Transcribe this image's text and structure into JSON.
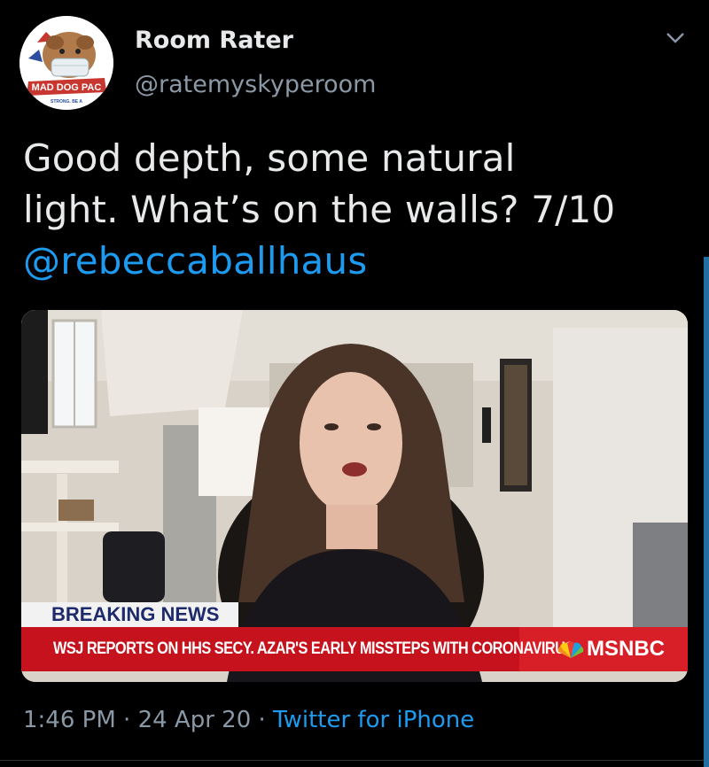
{
  "tweet": {
    "display_name": "Room Rater",
    "handle": "@ratemyskyperoom",
    "text_line1": "Good depth, some natural",
    "text_line2": "light. What’s on the walls? 7/10",
    "mention": "@rebeccaballhaus",
    "time": "1:46 PM",
    "separator": " · ",
    "date": "24 Apr 20",
    "source": "Twitter for iPhone"
  },
  "avatar": {
    "logo_text": "MAD DOG PAC",
    "logo_subtext": "STRONG. BE A"
  },
  "media": {
    "breaking_label": "BREAKING NEWS",
    "ticker": "WSJ REPORTS ON HHS SECY. AZAR'S EARLY MISSTEPS WITH CORONAVIRUS",
    "network": "MSNBC"
  },
  "colors": {
    "background": "#000000",
    "link": "#1d9bf0",
    "secondary_text": "#8b98a5",
    "ticker_red": "#c5121c"
  }
}
